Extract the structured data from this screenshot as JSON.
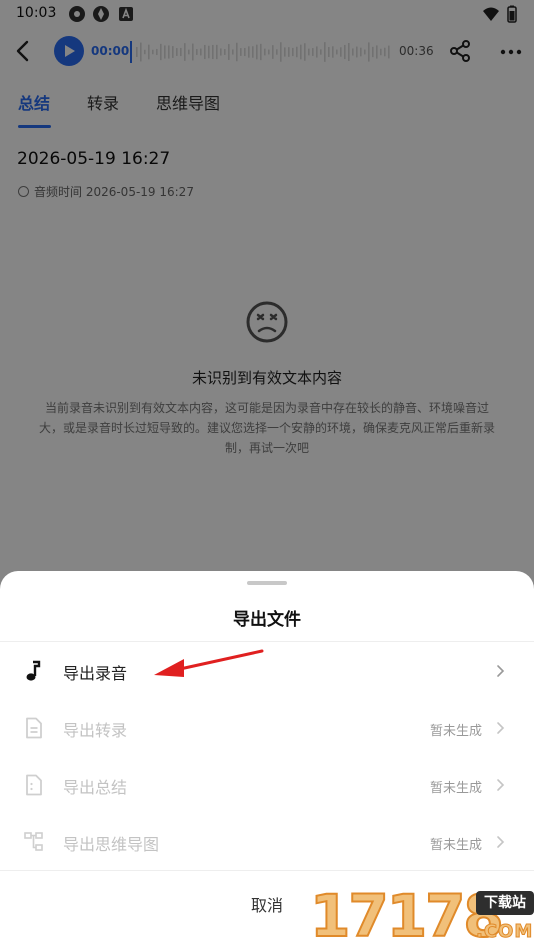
{
  "status_bar": {
    "time": "10:03"
  },
  "player": {
    "current_time": "00:00",
    "total_time": "00:36"
  },
  "tabs": [
    {
      "label": "总结",
      "active": true
    },
    {
      "label": "转录",
      "active": false
    },
    {
      "label": "思维导图",
      "active": false
    }
  ],
  "record": {
    "title": "2026-05-19 16:27",
    "audio_time_label": "音频时间 2026-05-19 16:27"
  },
  "empty_state": {
    "icon": "sad-face-icon",
    "title": "未识别到有效文本内容",
    "description": "当前录音未识别到有效文本内容，这可能是因为录音中存在较长的静音、环境噪音过大，或是录音时长过短导致的。建议您选择一个安静的环境，确保麦克风正常后重新录制，再试一次吧"
  },
  "sheet": {
    "title": "导出文件",
    "items": [
      {
        "label": "导出录音",
        "status": "",
        "enabled": true,
        "icon": "music-note-icon"
      },
      {
        "label": "导出转录",
        "status": "暂未生成",
        "enabled": false,
        "icon": "document-icon"
      },
      {
        "label": "导出总结",
        "status": "暂未生成",
        "enabled": false,
        "icon": "summary-icon"
      },
      {
        "label": "导出思维导图",
        "status": "暂未生成",
        "enabled": false,
        "icon": "mindmap-icon"
      }
    ],
    "cancel_label": "取消"
  },
  "watermark": {
    "digits": "17178",
    "badge": "下载站",
    "domain": ".COM"
  },
  "colors": {
    "accent": "#2a6bf2",
    "annotation_arrow": "#e02020"
  }
}
